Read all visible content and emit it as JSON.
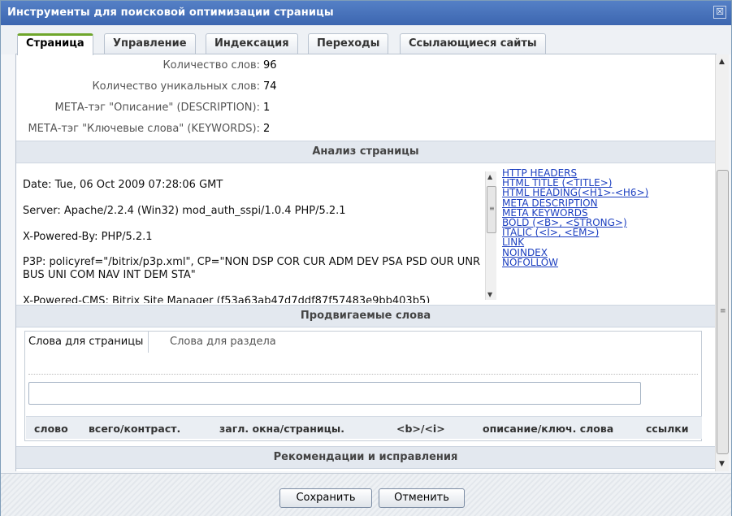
{
  "window": {
    "title": "Инструменты для поисковой оптимизации страницы",
    "close_glyph": "☒"
  },
  "tabs": [
    {
      "label": "Страница",
      "active": true
    },
    {
      "label": "Управление"
    },
    {
      "label": "Индексация"
    },
    {
      "label": "Переходы"
    },
    {
      "label": "Ссылающиеся сайты"
    }
  ],
  "stats": [
    {
      "label": "Количество слов:",
      "value": "96"
    },
    {
      "label": "Количество уникальных слов:",
      "value": "74"
    },
    {
      "label": "МЕТА-тэг \"Описание\" (DESCRIPTION):",
      "value": "1"
    },
    {
      "label": "МЕТА-тэг \"Ключевые слова\" (KEYWORDS):",
      "value": "2"
    }
  ],
  "analysis": {
    "title": "Анализ страницы",
    "headers": [
      "Date: Tue, 06 Oct 2009 07:28:06 GMT",
      "Server: Apache/2.2.4 (Win32) mod_auth_sspi/1.0.4 PHP/5.2.1",
      "X-Powered-By: PHP/5.2.1",
      "P3P: policyref=\"/bitrix/p3p.xml\", CP=\"NON DSP COR CUR ADM DEV PSA PSD OUR UNR BUS UNI COM NAV INT DEM STA\"",
      "X-Powered-CMS: Bitrix Site Manager (f53a63ab47d7ddf87f57483e9bb403b5)"
    ],
    "links": [
      "HTTP HEADERS",
      "HTML TITLE (<TITLE>)",
      "HTML HEADING(<H1>-<H6>)",
      "META DESCRIPTION",
      "META KEYWORDS",
      "BOLD (<B>, <STRONG>)",
      "ITALIC (<I>, <EM>)",
      "LINK",
      "NOINDEX",
      "NOFOLLOW"
    ]
  },
  "promoted": {
    "title": "Продвигаемые слова",
    "tabs": [
      "Слова для страницы",
      "Слова для раздела"
    ],
    "input_value": "",
    "columns": [
      "слово",
      "всего/контраст.",
      "загл. окна/страницы.",
      "<b>/<i>",
      "описание/ключ. слова",
      "ссылки"
    ]
  },
  "recommendations": {
    "title": "Рекомендации и исправления"
  },
  "buttons": {
    "save": "Сохранить",
    "cancel": "Отменить"
  },
  "scroll_glyphs": {
    "up": "▲",
    "down": "▼",
    "grip": "≡"
  }
}
